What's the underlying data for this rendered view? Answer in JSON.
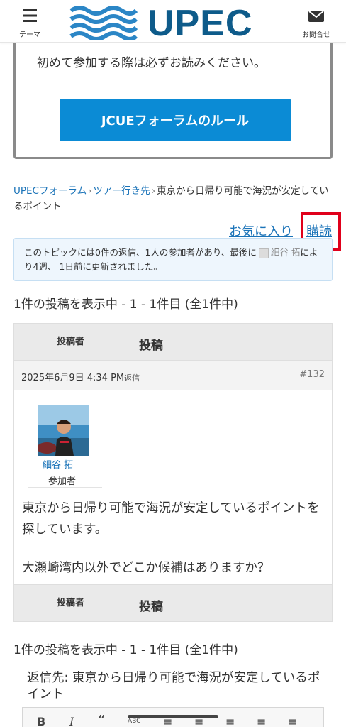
{
  "header": {
    "menu_label": "テーマ",
    "logo_text": "UPEC",
    "contact_label": "お問合せ"
  },
  "rules": {
    "note": "初めて参加する際は必ずお読みください。",
    "button_label": "JCUEフォーラムのルール"
  },
  "breadcrumb": {
    "items": [
      "UPECフォーラム",
      "ツアー行き先"
    ],
    "separator": "›",
    "current": "東京から日帰り可能で海況が安定しているポイント"
  },
  "actions": {
    "favorite": "お気に入り",
    "subscribe": "購読"
  },
  "notice": {
    "text_before": "このトピックには0件の返信、1人の参加者があり、最後に",
    "user": "細谷 拓",
    "text_after": "により4週、 1日前に更新されました。"
  },
  "pagination": {
    "summary": "1件の投稿を表示中 - 1 - 1件目 (全1件中)"
  },
  "table": {
    "col_author": "投稿者",
    "col_post": "投稿"
  },
  "post": {
    "date": "2025年6月9日 4:34 PM",
    "reply_label": "返信",
    "id": "#132",
    "author_name": "細谷 拓",
    "author_role": "参加者",
    "paragraph1": "東京から日帰り可能で海況が安定しているポイントを探しています。",
    "paragraph2": "大瀬崎湾内以外でどこか候補はありますか？"
  },
  "reply": {
    "title": "返信先: 東京から日帰り可能で海況が安定しているポイント"
  },
  "toolbar": {
    "bold": "B",
    "italic": "I",
    "quote": "“",
    "strike": "ABC",
    "ul": "≡",
    "ol": "≡",
    "align_left": "≡",
    "align_center": "≡",
    "align_right": "≡"
  },
  "colors": {
    "accent": "#0b8bd5",
    "logo": "#0e5b8a",
    "link": "#1a73b8",
    "highlight": "#e0001b"
  }
}
